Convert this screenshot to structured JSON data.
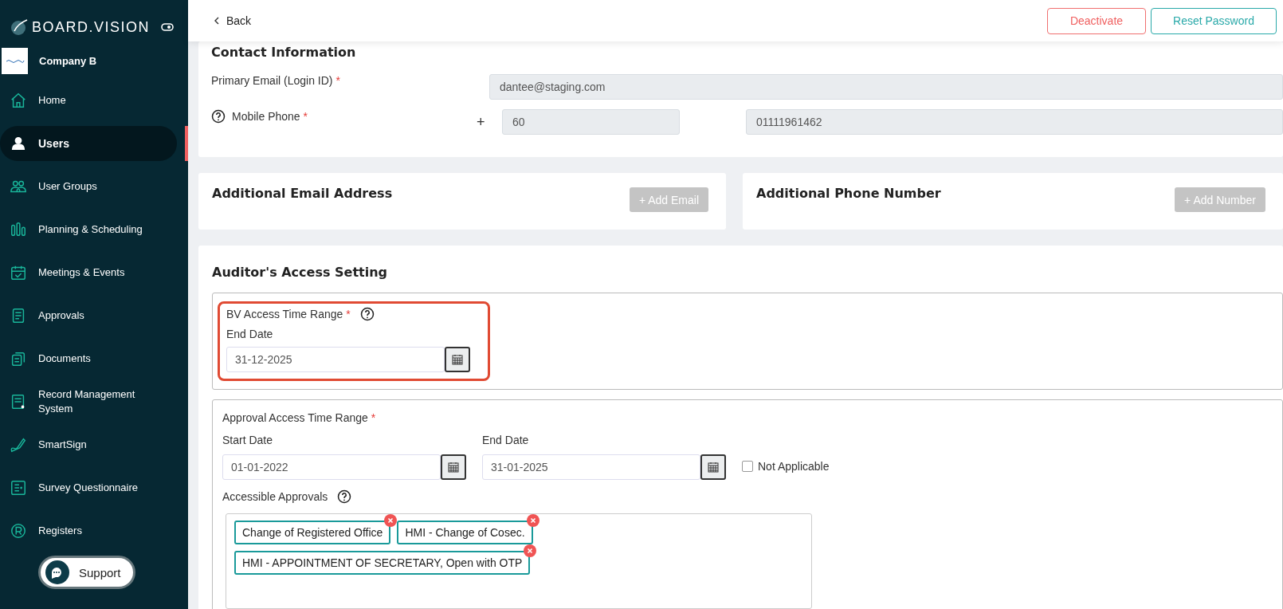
{
  "sidebar": {
    "brand": "BOARD.VISION",
    "company": {
      "name": "Company B"
    },
    "items": [
      {
        "label": "Home",
        "selected": false
      },
      {
        "label": "Users",
        "selected": true
      },
      {
        "label": "User Groups",
        "selected": false
      },
      {
        "label": "Planning & Scheduling",
        "selected": false
      },
      {
        "label": "Meetings & Events",
        "selected": false
      },
      {
        "label": "Approvals",
        "selected": false
      },
      {
        "label": "Documents",
        "selected": false
      },
      {
        "label": "Record Management System",
        "selected": false
      },
      {
        "label": "SmartSign",
        "selected": false
      },
      {
        "label": "Survey Questionnaire",
        "selected": false
      },
      {
        "label": "Registers",
        "selected": false
      }
    ],
    "support": "Support"
  },
  "header": {
    "back": "Back",
    "buttons": [
      {
        "label": "Deactivate",
        "kind": "danger"
      },
      {
        "label": "Reset Password",
        "kind": "primary"
      }
    ]
  },
  "contact": {
    "title": "Contact Information",
    "primary_email": {
      "label": "Primary Email (Login ID)",
      "required": "*",
      "value": "dantee@staging.com"
    },
    "mobile": {
      "label": "Mobile Phone",
      "required": "*",
      "plus": "+",
      "code": "60",
      "number": "01111961462"
    }
  },
  "additional_email": {
    "title": "Additional Email Address",
    "button": "+ Add Email"
  },
  "additional_phone": {
    "title": "Additional Phone Number",
    "button": "+ Add Number"
  },
  "auditor": {
    "title": "Auditor's Access Setting",
    "bv": {
      "label": "BV Access Time Range",
      "required": "*",
      "end_label": "End Date",
      "end_value": "31-12-2025"
    },
    "approval": {
      "label": "Approval Access Time Range",
      "required": "*",
      "start_label": "Start Date",
      "start_value": "01-01-2022",
      "end_label": "End Date",
      "end_value": "31-01-2025",
      "not_applicable": {
        "label": "Not Applicable",
        "checked": false
      },
      "accessible_label": "Accessible Approvals",
      "tags": [
        "Change of Registered Office",
        "HMI - Change of Cosec.",
        "HMI - APPOINTMENT OF SECRETARY, Open with OTP"
      ]
    }
  }
}
